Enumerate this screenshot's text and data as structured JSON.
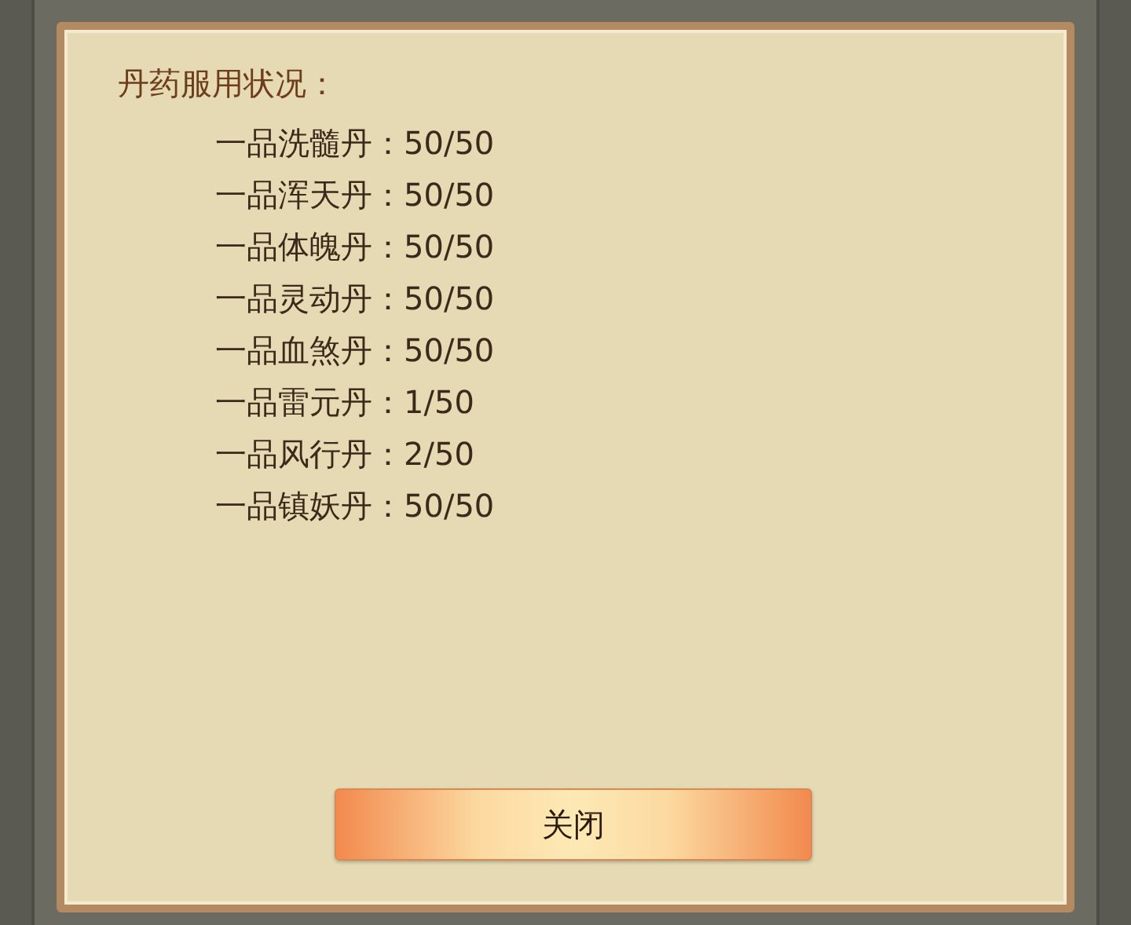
{
  "dialog": {
    "title": "丹药服用状况：",
    "items": [
      "一品洗髓丹：50/50",
      "一品浑天丹：50/50",
      "一品体魄丹：50/50",
      "一品灵动丹：50/50",
      "一品血煞丹：50/50",
      "一品雷元丹：1/50",
      "一品风行丹：2/50",
      "一品镇妖丹：50/50"
    ],
    "close_button": "关闭"
  }
}
